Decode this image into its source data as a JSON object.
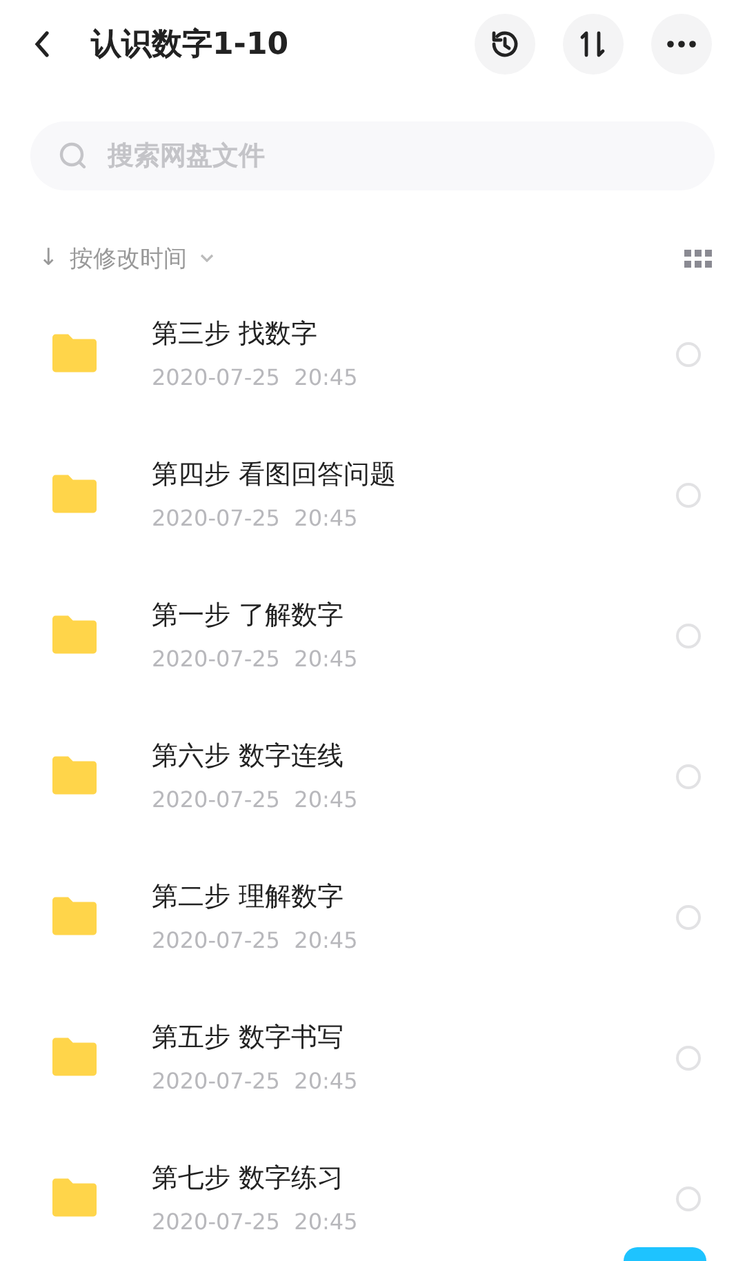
{
  "header": {
    "title": "认识数字1-10"
  },
  "search": {
    "placeholder": "搜索网盘文件"
  },
  "sort": {
    "arrow": "↓",
    "label": "按修改时间"
  },
  "files": [
    {
      "name": "第三步 找数字",
      "date": "2020-07-25  20:45",
      "selected": false
    },
    {
      "name": "第四步 看图回答问题",
      "date": "2020-07-25  20:45",
      "selected": false
    },
    {
      "name": "第一步 了解数字",
      "date": "2020-07-25  20:45",
      "selected": false
    },
    {
      "name": "第六步 数字连线",
      "date": "2020-07-25  20:45",
      "selected": false
    },
    {
      "name": "第二步 理解数字",
      "date": "2020-07-25  20:45",
      "selected": false
    },
    {
      "name": "第五步 数字书写",
      "date": "2020-07-25  20:45",
      "selected": false
    },
    {
      "name": "第七步 数字练习",
      "date": "2020-07-25  20:45",
      "selected": false
    }
  ]
}
